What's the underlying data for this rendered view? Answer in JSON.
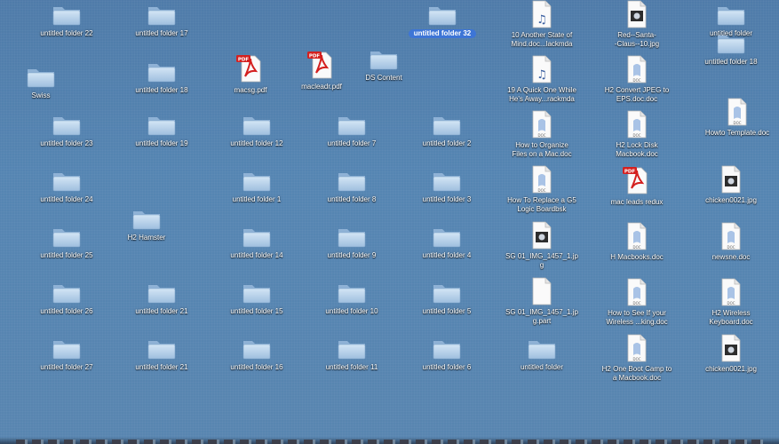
{
  "desktop": {
    "items": [
      {
        "label": "untitled folder 22",
        "icon": "folder-icon"
      },
      {
        "label": "untitled folder 17",
        "icon": "folder-icon"
      },
      {
        "label": "untitled folder 32",
        "icon": "folder-icon",
        "selected": true
      },
      {
        "label": "10 Another State of\nMind.doc...lackmda",
        "icon": "music-doc-icon"
      },
      {
        "label": "Red--Santa-\n-Claus--10.jpg",
        "icon": "image-doc-icon"
      },
      {
        "label": "untitled folder",
        "icon": "folder-icon"
      },
      {
        "label": "untitled folder 18",
        "icon": "folder-icon"
      },
      {
        "label": "Swiss",
        "icon": "folder-icon"
      },
      {
        "label": "untitled folder 18",
        "icon": "folder-icon"
      },
      {
        "label": "macsg.pdf",
        "icon": "pdf-icon"
      },
      {
        "label": "macleadr.pdf",
        "icon": "pdf-icon"
      },
      {
        "label": "DS Content",
        "icon": "folder-icon"
      },
      {
        "label": "19 A Quick One While\nHe's Away...rackmda",
        "icon": "music-doc-icon"
      },
      {
        "label": "H2 Convert JPEG to\nEPS.doc.doc",
        "icon": "doc-icon"
      },
      {
        "label": "Howto Template.doc",
        "icon": "doc-icon"
      },
      {
        "label": "untitled folder 23",
        "icon": "folder-icon"
      },
      {
        "label": "untitled folder 19",
        "icon": "folder-icon"
      },
      {
        "label": "untitled folder 12",
        "icon": "folder-icon"
      },
      {
        "label": "untitled folder 7",
        "icon": "folder-icon"
      },
      {
        "label": "untitled folder 2",
        "icon": "folder-icon"
      },
      {
        "label": "How to Organize\nFiles on a Mac.doc",
        "icon": "doc-icon"
      },
      {
        "label": "H2 Lock Disk\nMacbook.doc",
        "icon": "doc-icon"
      },
      {
        "label": "untitled folder 24",
        "icon": "folder-icon"
      },
      {
        "label": "untitled folder 1",
        "icon": "folder-icon"
      },
      {
        "label": "untitled folder 8",
        "icon": "folder-icon"
      },
      {
        "label": "untitled folder 3",
        "icon": "folder-icon"
      },
      {
        "label": "How To Replace a G5\nLogic Boardbsk",
        "icon": "doc-icon"
      },
      {
        "label": "mac leads redux",
        "icon": "pdf-icon"
      },
      {
        "label": "chicken0021.jpg",
        "icon": "image-doc-icon"
      },
      {
        "label": "H2 Hamster",
        "icon": "folder-icon"
      },
      {
        "label": "untitled folder 25",
        "icon": "folder-icon"
      },
      {
        "label": "untitled folder 14",
        "icon": "folder-icon"
      },
      {
        "label": "untitled folder 9",
        "icon": "folder-icon"
      },
      {
        "label": "untitled folder 4",
        "icon": "folder-icon"
      },
      {
        "label": "SG 01_IMG_1457_1.jp\ng",
        "icon": "image-doc-icon"
      },
      {
        "label": "H Macbooks.doc",
        "icon": "doc-icon"
      },
      {
        "label": "newsne.doc",
        "icon": "doc-icon"
      },
      {
        "label": "untitled folder 26",
        "icon": "folder-icon"
      },
      {
        "label": "untitled folder 21",
        "icon": "folder-icon"
      },
      {
        "label": "untitled folder 15",
        "icon": "folder-icon"
      },
      {
        "label": "untitled folder 10",
        "icon": "folder-icon"
      },
      {
        "label": "untitled folder 5",
        "icon": "folder-icon"
      },
      {
        "label": "SG 01_IMG_1457_1.jp\ng.part",
        "icon": "blank-doc-icon"
      },
      {
        "label": "How to See If your\nWireless ...king.doc",
        "icon": "doc-icon"
      },
      {
        "label": "H2 Wireless\nKeyboard.doc",
        "icon": "doc-icon"
      },
      {
        "label": "untitled folder 27",
        "icon": "folder-icon"
      },
      {
        "label": "untitled folder 21",
        "icon": "folder-icon"
      },
      {
        "label": "untitled folder 16",
        "icon": "folder-icon"
      },
      {
        "label": "untitled folder 11",
        "icon": "folder-icon"
      },
      {
        "label": "untitled folder 6",
        "icon": "folder-icon"
      },
      {
        "label": "untitled folder",
        "icon": "folder-icon"
      },
      {
        "label": "H2 One Boot Camp to\na Macbook.doc",
        "icon": "doc-icon"
      },
      {
        "label": "chicken0021.jpg",
        "icon": "image-doc-icon"
      }
    ]
  },
  "colors": {
    "desktop": "#5582ae",
    "folder": "#b9d2ea",
    "selection": "#3d75d6",
    "pdf_red": "#d4201f"
  }
}
